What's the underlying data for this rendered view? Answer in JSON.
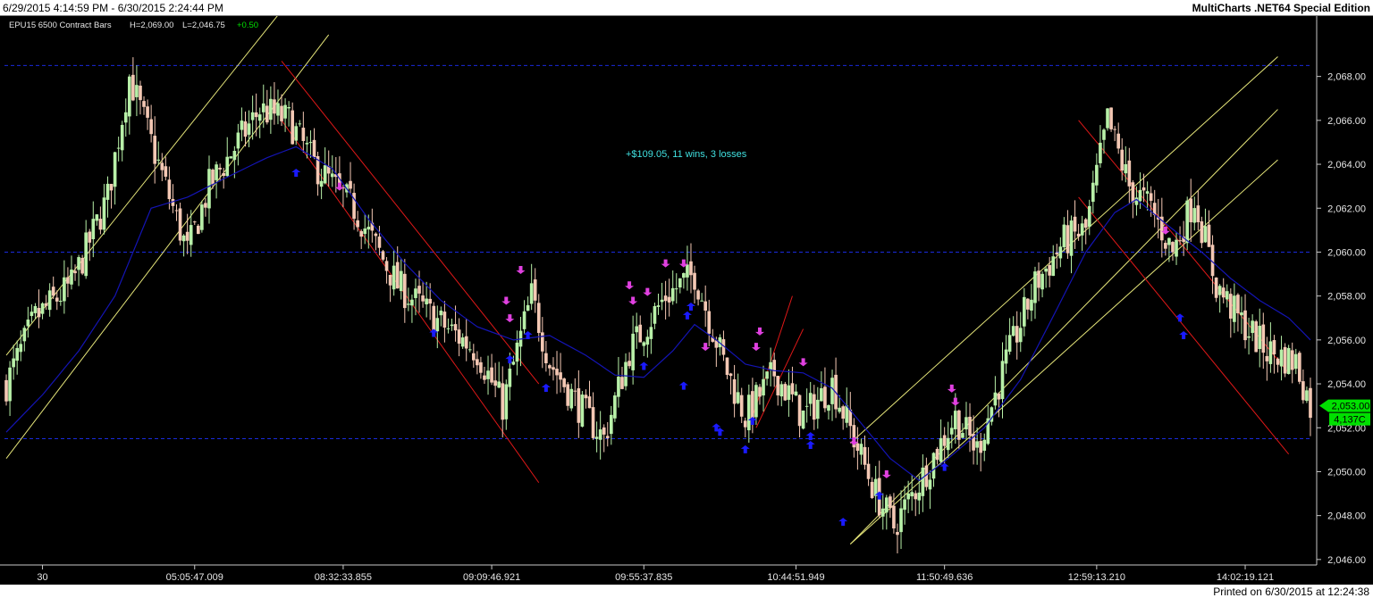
{
  "header": {
    "date_range": "6/29/2015 4:14:59 PM - 6/30/2015 2:24:44 PM",
    "edition": "MultiCharts .NET64 Special Edition"
  },
  "footer": {
    "printed": "Printed on 6/30/2015 at 12:24:38"
  },
  "colors": {
    "background": "#000000",
    "up_candle": "#b8f0a8",
    "down_candle": "#f4c8b4",
    "moving_average": "#1414b4",
    "grid": "#1a2adc",
    "up_channel": "#e6e67a",
    "down_channel": "#e01818",
    "sell_arrow": "#e040e0",
    "buy_arrow": "#1a1aff",
    "price_marker": "#00e000",
    "strategy_text": "#40e0e0"
  },
  "chart_data": {
    "type": "candlestick",
    "instrument_label": "EPU15  6500 Contract Bars",
    "high_label": "H=2,069.00",
    "low_label": "L=2,046.75",
    "change_label": "+0.50",
    "strategy_summary": "+$109.05, 11 wins, 3 losses",
    "last_price_label": "2,053.00",
    "last_volume_label": "4,137C",
    "ylim": [
      2045.75,
      2070.75
    ],
    "y_ticks": [
      2046,
      2048,
      2050,
      2052,
      2054,
      2056,
      2058,
      2060,
      2062,
      2064,
      2066,
      2068
    ],
    "y_tick_labels": [
      "2,046.00",
      "2,048.00",
      "2,050.00",
      "2,052.00",
      "2,054.00",
      "2,056.00",
      "2,058.00",
      "2,060.00",
      "2,062.00",
      "2,064.00",
      "2,066.00",
      "2,068.00"
    ],
    "grid_levels": [
      2068.5,
      2060.0,
      2051.5
    ],
    "x_ticks": [
      {
        "bar": 10,
        "label": "30"
      },
      {
        "bar": 52,
        "label": "05:05:47.009"
      },
      {
        "bar": 93,
        "label": "08:32:33.855"
      },
      {
        "bar": 134,
        "label": "09:09:46.921"
      },
      {
        "bar": 176,
        "label": "09:55:37.835"
      },
      {
        "bar": 218,
        "label": "10:44:51.949"
      },
      {
        "bar": 259,
        "label": "11:50:49.636"
      },
      {
        "bar": 301,
        "label": "12:59:13.210"
      },
      {
        "bar": 342,
        "label": "14:02:19.121"
      }
    ],
    "price_path": [
      [
        0,
        2054.0
      ],
      [
        8,
        2057.0
      ],
      [
        18,
        2058.5
      ],
      [
        28,
        2062.5
      ],
      [
        34,
        2068.0
      ],
      [
        44,
        2063.0
      ],
      [
        50,
        2060.0
      ],
      [
        56,
        2063.0
      ],
      [
        62,
        2064.5
      ],
      [
        70,
        2066.5
      ],
      [
        78,
        2066.0
      ],
      [
        85,
        2064.0
      ],
      [
        96,
        2062.0
      ],
      [
        108,
        2058.5
      ],
      [
        118,
        2057.0
      ],
      [
        130,
        2055.5
      ],
      [
        137,
        2053.0
      ],
      [
        145,
        2058.0
      ],
      [
        150,
        2055.0
      ],
      [
        158,
        2053.0
      ],
      [
        165,
        2051.5
      ],
      [
        172,
        2055.5
      ],
      [
        182,
        2058.0
      ],
      [
        190,
        2059.0
      ],
      [
        198,
        2055.0
      ],
      [
        204,
        2052.5
      ],
      [
        212,
        2054.5
      ],
      [
        220,
        2052.5
      ],
      [
        228,
        2054.0
      ],
      [
        234,
        2051.5
      ],
      [
        240,
        2049.0
      ],
      [
        245,
        2047.5
      ],
      [
        252,
        2049.5
      ],
      [
        262,
        2052.5
      ],
      [
        268,
        2051.0
      ],
      [
        276,
        2055.0
      ],
      [
        284,
        2058.5
      ],
      [
        292,
        2060.5
      ],
      [
        298,
        2061.0
      ],
      [
        304,
        2066.0
      ],
      [
        310,
        2063.0
      ],
      [
        316,
        2062.0
      ],
      [
        322,
        2060.0
      ],
      [
        328,
        2062.5
      ],
      [
        334,
        2058.5
      ],
      [
        340,
        2057.0
      ],
      [
        348,
        2055.5
      ],
      [
        356,
        2055.0
      ],
      [
        360,
        2053.0
      ]
    ],
    "moving_average": [
      [
        0,
        2051.8
      ],
      [
        10,
        2053.5
      ],
      [
        20,
        2055.5
      ],
      [
        30,
        2058.0
      ],
      [
        40,
        2062.0
      ],
      [
        50,
        2062.5
      ],
      [
        62,
        2063.5
      ],
      [
        72,
        2064.3
      ],
      [
        80,
        2064.8
      ],
      [
        90,
        2063.8
      ],
      [
        100,
        2061.5
      ],
      [
        110,
        2059.5
      ],
      [
        120,
        2057.8
      ],
      [
        130,
        2056.6
      ],
      [
        140,
        2056.0
      ],
      [
        150,
        2056.2
      ],
      [
        160,
        2055.3
      ],
      [
        168,
        2054.4
      ],
      [
        176,
        2054.3
      ],
      [
        184,
        2055.5
      ],
      [
        190,
        2056.7
      ],
      [
        196,
        2056.0
      ],
      [
        204,
        2054.9
      ],
      [
        212,
        2054.6
      ],
      [
        220,
        2054.5
      ],
      [
        228,
        2053.8
      ],
      [
        236,
        2052.2
      ],
      [
        244,
        2050.6
      ],
      [
        252,
        2049.6
      ],
      [
        260,
        2050.6
      ],
      [
        270,
        2052.0
      ],
      [
        280,
        2054.2
      ],
      [
        290,
        2057.4
      ],
      [
        298,
        2060.0
      ],
      [
        306,
        2061.8
      ],
      [
        312,
        2062.4
      ],
      [
        320,
        2061.3
      ],
      [
        330,
        2060.0
      ],
      [
        338,
        2058.8
      ],
      [
        346,
        2057.8
      ],
      [
        354,
        2057.0
      ],
      [
        360,
        2056.0
      ]
    ],
    "channels": [
      {
        "color": "up",
        "from": [
          0,
          2055.3
        ],
        "to": [
          76,
          2071.0
        ]
      },
      {
        "color": "up",
        "from": [
          0,
          2050.6
        ],
        "to": [
          89,
          2069.9
        ]
      },
      {
        "color": "down",
        "from": [
          76,
          2068.7
        ],
        "to": [
          147,
          2054.0
        ]
      },
      {
        "color": "down",
        "from": [
          76,
          2066.0
        ],
        "to": [
          147,
          2049.5
        ]
      },
      {
        "color": "down",
        "from": [
          206,
          2052.5
        ],
        "to": [
          217,
          2058.0
        ]
      },
      {
        "color": "down",
        "from": [
          207,
          2052.0
        ],
        "to": [
          220,
          2056.5
        ]
      },
      {
        "color": "up",
        "from": [
          233,
          2051.3
        ],
        "to": [
          351,
          2068.9
        ]
      },
      {
        "color": "up",
        "from": [
          233,
          2046.7
        ],
        "to": [
          351,
          2066.5
        ]
      },
      {
        "color": "up",
        "from": [
          233,
          2046.7
        ],
        "to": [
          351,
          2064.2
        ]
      },
      {
        "color": "down",
        "from": [
          296,
          2066.0
        ],
        "to": [
          354,
          2054.5
        ]
      },
      {
        "color": "down",
        "from": [
          296,
          2062.5
        ],
        "to": [
          354,
          2050.8
        ]
      }
    ],
    "sell_signals": [
      [
        92,
        2062.8
      ],
      [
        142,
        2059.0
      ],
      [
        138,
        2057.6
      ],
      [
        139,
        2056.8
      ],
      [
        172,
        2058.3
      ],
      [
        173,
        2057.6
      ],
      [
        177,
        2058.0
      ],
      [
        182,
        2059.3
      ],
      [
        187,
        2059.3
      ],
      [
        193,
        2055.5
      ],
      [
        207,
        2055.5
      ],
      [
        208,
        2056.2
      ],
      [
        220,
        2054.8
      ],
      [
        234,
        2051.2
      ],
      [
        243,
        2049.7
      ],
      [
        261,
        2053.6
      ],
      [
        262,
        2053.0
      ],
      [
        320,
        2060.8
      ]
    ],
    "buy_signals": [
      [
        80,
        2063.8
      ],
      [
        118,
        2056.5
      ],
      [
        139,
        2055.3
      ],
      [
        144,
        2056.4
      ],
      [
        149,
        2054.0
      ],
      [
        176,
        2055.0
      ],
      [
        187,
        2054.1
      ],
      [
        188,
        2057.3
      ],
      [
        189,
        2057.7
      ],
      [
        196,
        2052.2
      ],
      [
        197,
        2052.0
      ],
      [
        204,
        2051.2
      ],
      [
        206,
        2052.5
      ],
      [
        222,
        2051.8
      ],
      [
        222,
        2051.4
      ],
      [
        231,
        2047.9
      ],
      [
        241,
        2049.1
      ],
      [
        259,
        2050.4
      ],
      [
        324,
        2057.2
      ],
      [
        325,
        2056.4
      ]
    ],
    "current_price": 2053.0
  }
}
